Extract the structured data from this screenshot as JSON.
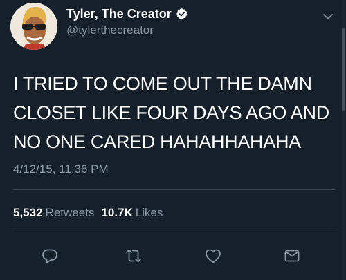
{
  "tweet": {
    "author_name": "Tyler, The Creator",
    "handle": "@tylerthecreator",
    "verified": true,
    "text_lines": [
      "I TRIED TO COME OUT THE DAMN",
      "CLOSET LIKE FOUR DAYS AGO AND",
      "NO ONE CARED HAHAHHAHAHA"
    ],
    "timestamp": "4/12/15, 11:36 PM",
    "retweets_count": "5,532",
    "retweets_label": "Retweets",
    "likes_count": "10.7K",
    "likes_label": "Likes"
  },
  "icons": {
    "avatar": "profile-avatar",
    "verified": "verified-badge-icon",
    "menu": "chevron-down-icon",
    "actions": [
      "reply-icon",
      "retweet-icon",
      "like-icon",
      "direct-message-icon"
    ]
  },
  "colors": {
    "background": "#15202b",
    "primary_text": "#ffffff",
    "secondary_text": "#8899a6",
    "divider": "#38444d"
  }
}
